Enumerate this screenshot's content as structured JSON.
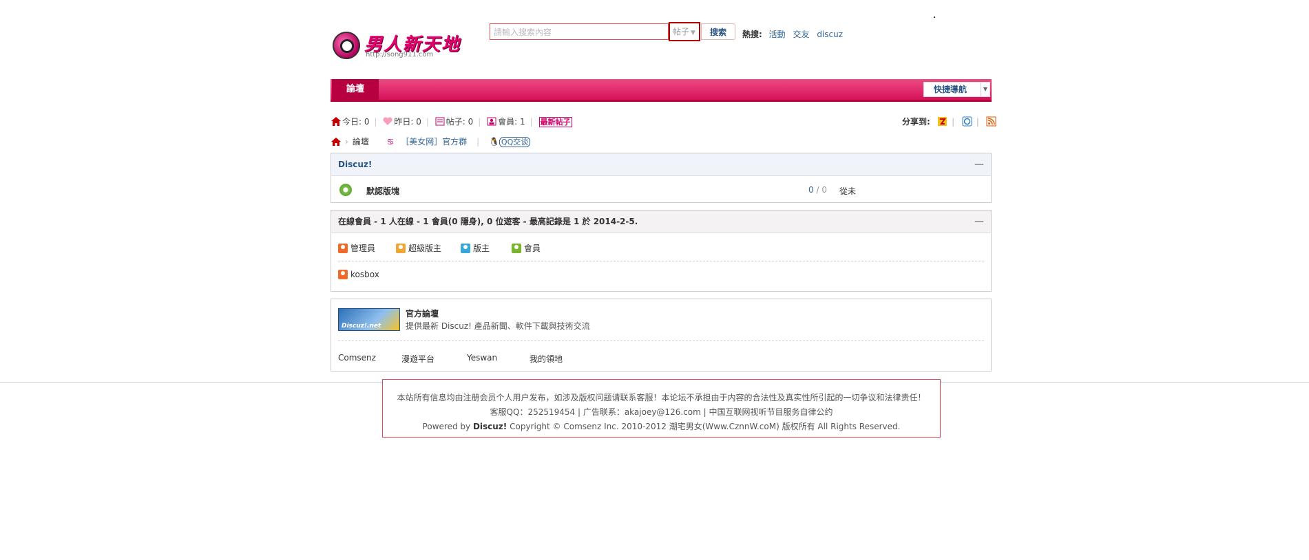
{
  "header": {
    "logo_title": "男人新天地",
    "logo_url": "http://song911.com",
    "search_placeholder": "請輸入搜索內容",
    "search_type": "帖子",
    "search_button": "搜索",
    "hot_label": "熱搜:",
    "hot_links": [
      "活動",
      "交友",
      "discuz"
    ]
  },
  "nav": {
    "tab": "論壇",
    "quick_nav": "快捷導航"
  },
  "stats": {
    "today": "今日: 0",
    "yesterday": "昨日: 0",
    "posts": "帖子: 0",
    "members": "會員: 1",
    "new_posts": "最新帖子",
    "share_label": "分享到:"
  },
  "breadcrumb": {
    "current": "論壇",
    "group_link": "［美女网］官方群",
    "qq_link": "QQ交谈"
  },
  "forum": {
    "category": "Discuz!",
    "name": "默認版塊",
    "threads": "0",
    "posts": "0",
    "last_post": "從未"
  },
  "online": {
    "title": "在線會員 - 1 人在線 - 1 會員(0 隱身), 0 位遊客 - 最高記錄是 1 於 2014-2-5.",
    "legend": [
      "管理員",
      "超級版主",
      "版主",
      "會員"
    ],
    "users": [
      "kosbox"
    ]
  },
  "links": {
    "logo_text": "Discuz!.net",
    "title": "官方論壇",
    "desc": "提供最新 Discuz! 產品新聞、軟件下載與技術交流",
    "text_links": [
      "Comsenz",
      "漫遊平台",
      "Yeswan",
      "我的領地"
    ]
  },
  "footer": {
    "line1": "本站所有信息均由注册会员个人用户发布，如涉及版权问题请联系客服！本论坛不承担由于内容的合法性及真实性所引起的一切争议和法律责任！",
    "line2": "客服QQ：252519454 | 广告联系：akajoey@126.com |   中国互联网视听节目服务自律公约",
    "powered": "Powered by",
    "discuz": "Discuz!",
    "copyright": "Copyright © Comsenz Inc. 2010-2012 潮宅男女(Www.CznnW.coM) 版权所有 All Rights Reserved."
  },
  "colors": {
    "brand": "#e6006e",
    "nav": "#d6125a",
    "link": "#336699"
  }
}
